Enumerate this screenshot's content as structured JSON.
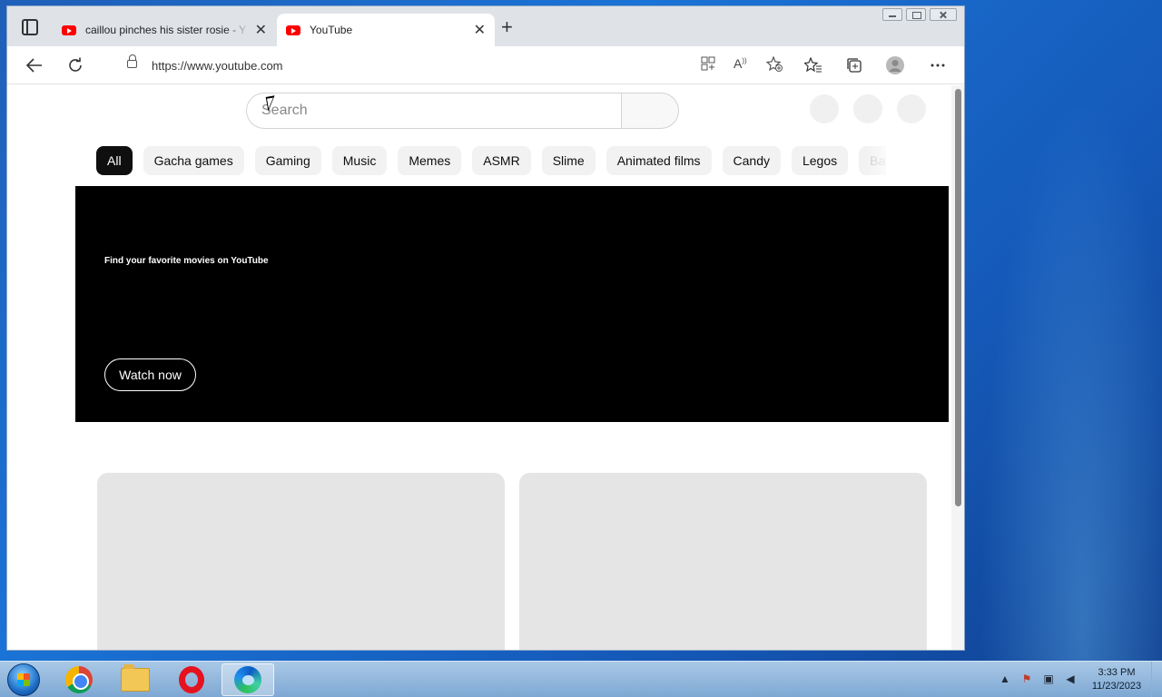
{
  "browser": {
    "tabs": [
      {
        "title": "caillou pinches his sister rosie - Y",
        "icon": "youtube-icon",
        "active": false
      },
      {
        "title": "YouTube",
        "icon": "youtube-icon",
        "active": true
      }
    ],
    "new_tab_symbol": "+",
    "close_symbol": "✕",
    "url": "https://www.youtube.com",
    "toolbar_icons": [
      "back-icon",
      "refresh-icon",
      "lock-icon",
      "apps-icon",
      "read-aloud-icon",
      "add-favorite-icon",
      "favorites-icon",
      "collections-icon",
      "profile-icon",
      "more-icon"
    ]
  },
  "youtube": {
    "search_placeholder": "Search",
    "chips": [
      "All",
      "Gacha games",
      "Gaming",
      "Music",
      "Memes",
      "ASMR",
      "Slime",
      "Animated films",
      "Candy",
      "Legos",
      "Ba"
    ],
    "banner": {
      "text": "Find your favorite movies on YouTube",
      "button_label": "Watch now"
    }
  },
  "taskbar": {
    "apps": [
      "chrome-icon",
      "file-explorer-icon",
      "opera-icon",
      "edge-icon"
    ],
    "time": "3:33 PM",
    "date": "11/23/2023"
  }
}
